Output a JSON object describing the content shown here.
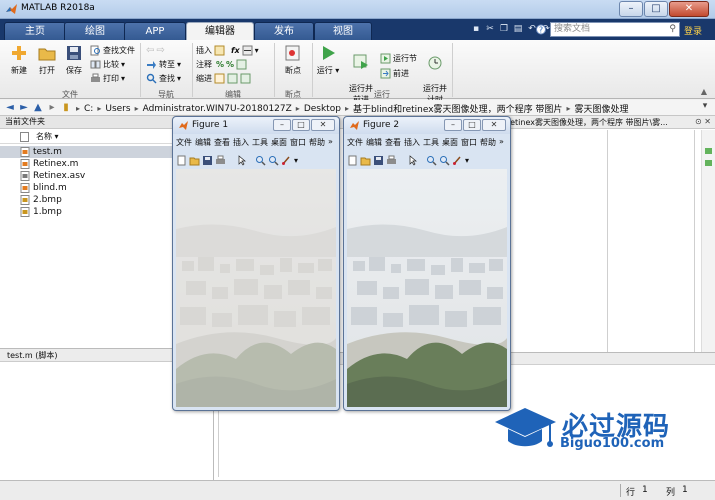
{
  "window": {
    "title": "MATLAB R2018a",
    "login_label": "登录"
  },
  "tabs": [
    {
      "label": "主页"
    },
    {
      "label": "绘图"
    },
    {
      "label": "APP"
    },
    {
      "label": "编辑器"
    },
    {
      "label": "发布"
    },
    {
      "label": "视图"
    }
  ],
  "search": {
    "placeholder": "搜索文档"
  },
  "ribbon": {
    "file": {
      "label": "文件",
      "new": "新建",
      "open": "打开",
      "save": "保存",
      "find_files": "查找文件",
      "compare": "比较",
      "print": "打印"
    },
    "navigate": {
      "label": "导航",
      "goto": "转至",
      "find": "查找"
    },
    "edit": {
      "label": "编辑",
      "insert": "插入",
      "comment": "注释",
      "indent": "缩进",
      "fx": "fx"
    },
    "breakpoints": {
      "label": "断点",
      "breakpoints": "断点"
    },
    "run": {
      "label": "运行",
      "run": "运行",
      "run_advance": "运行并\n前进",
      "run_section": "运行节",
      "advance": "前进",
      "run_time": "运行并\n计时"
    }
  },
  "address": {
    "segments": [
      "C:",
      "Users",
      "Administrator.WIN7U-20180127Z",
      "Desktop",
      "基于blind和retinex雾天图像处理，两个程序 带图片",
      "雾天图像处理"
    ]
  },
  "file_browser": {
    "title": "当前文件夹",
    "column_name": "名称",
    "files": [
      {
        "name": "test.m",
        "type": "m",
        "selected": true
      },
      {
        "name": "Retinex.m",
        "type": "m",
        "selected": false
      },
      {
        "name": "Retinex.asv",
        "type": "asv",
        "selected": false
      },
      {
        "name": "blind.m",
        "type": "m",
        "selected": false
      },
      {
        "name": "2.bmp",
        "type": "bmp",
        "selected": false
      },
      {
        "name": "1.bmp",
        "type": "bmp",
        "selected": false
      }
    ]
  },
  "details": {
    "label": "test.m  (脚本)"
  },
  "editor": {
    "tab_text": "retinex雾天图像处理，两个程序 带图片\\雾..."
  },
  "status": {
    "row_label": "行",
    "row_value": "1",
    "col_label": "列",
    "col_value": "1"
  },
  "figures": [
    {
      "title": "Figure 1",
      "menu": [
        "文件",
        "编辑",
        "查看",
        "插入",
        "工具",
        "桌面",
        "窗口",
        "帮助"
      ],
      "haze": "heavy"
    },
    {
      "title": "Figure 2",
      "menu": [
        "文件",
        "编辑",
        "查看",
        "插入",
        "工具",
        "桌面",
        "窗口",
        "帮助"
      ],
      "haze": "light"
    }
  ],
  "watermark": {
    "text": "必过源码",
    "sub": "Biguo100.com"
  },
  "colors": {
    "tab_bar": "#19386b",
    "accent": "#1f63b8",
    "matlab_orange": "#e06a1c"
  }
}
